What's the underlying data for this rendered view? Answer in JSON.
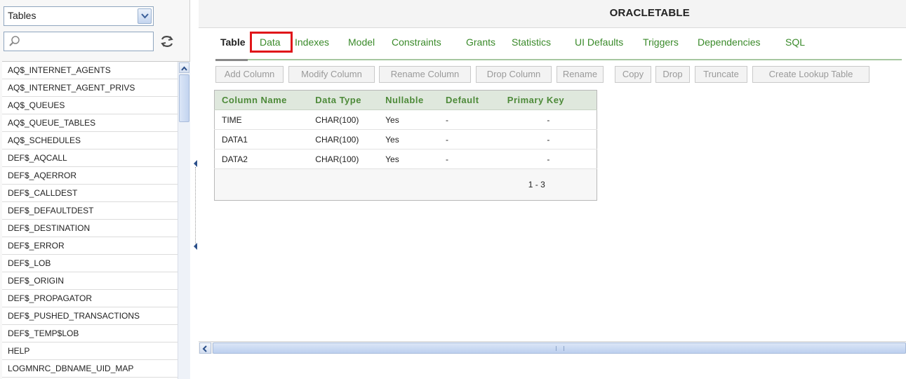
{
  "left_panel": {
    "object_type": "Tables",
    "search_value": "",
    "objects": [
      "AQ$_INTERNET_AGENTS",
      "AQ$_INTERNET_AGENT_PRIVS",
      "AQ$_QUEUES",
      "AQ$_QUEUE_TABLES",
      "AQ$_SCHEDULES",
      "DEF$_AQCALL",
      "DEF$_AQERROR",
      "DEF$_CALLDEST",
      "DEF$_DEFAULTDEST",
      "DEF$_DESTINATION",
      "DEF$_ERROR",
      "DEF$_LOB",
      "DEF$_ORIGIN",
      "DEF$_PROPAGATOR",
      "DEF$_PUSHED_TRANSACTIONS",
      "DEF$_TEMP$LOB",
      "HELP",
      "LOGMNRC_DBNAME_UID_MAP"
    ]
  },
  "main": {
    "title": "ORACLETABLE",
    "tabs": [
      "Table",
      "Data",
      "Indexes",
      "Model",
      "Constraints",
      "Grants",
      "Statistics",
      "UI Defaults",
      "Triggers",
      "Dependencies",
      "SQL"
    ],
    "active_tab": "Table",
    "highlighted_tab": "Data",
    "toolbar": [
      "Add Column",
      "Modify Column",
      "Rename Column",
      "Drop Column",
      "Rename",
      "Copy",
      "Drop",
      "Truncate",
      "Create Lookup Table"
    ],
    "table": {
      "headers": [
        "Column Name",
        "Data Type",
        "Nullable",
        "Default",
        "Primary Key"
      ],
      "rows": [
        [
          "TIME",
          "CHAR(100)",
          "Yes",
          "-",
          "-"
        ],
        [
          "DATA1",
          "CHAR(100)",
          "Yes",
          "-",
          "-"
        ],
        [
          "DATA2",
          "CHAR(100)",
          "Yes",
          "-",
          "-"
        ]
      ],
      "pagination": "1 - 3"
    }
  },
  "colors": {
    "tab_green": "#3a8a2a",
    "header_green": "#4d8a39",
    "highlight_red": "#e0161a",
    "scroll_blue": "#c3d4ef"
  }
}
